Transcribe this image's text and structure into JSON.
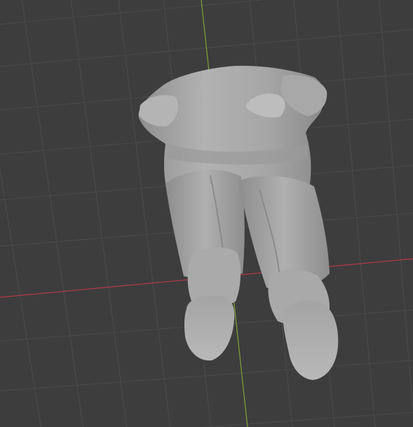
{
  "viewport": {
    "kind": "3d-viewport",
    "background_color": "#3d3d3d",
    "grid_line_color": "#4a4a4a",
    "x_axis_color": "#b53a45",
    "y_axis_color": "#7fa33a"
  },
  "scene": {
    "object": "seated-human-figure-mesh",
    "view": "perspective-from-below",
    "material_color": "#a9a9a9",
    "shading": "solid"
  }
}
